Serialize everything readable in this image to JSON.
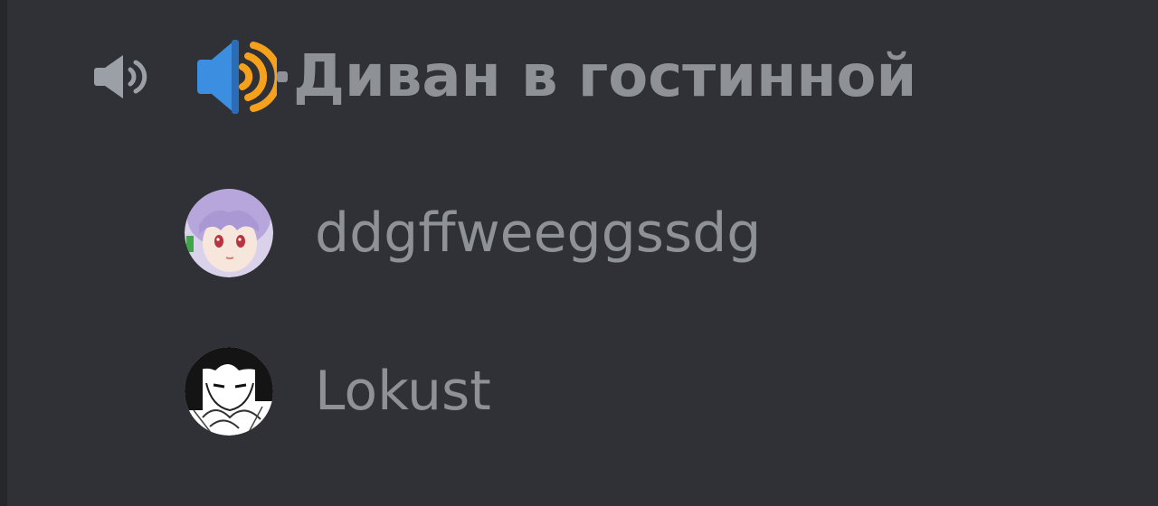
{
  "voice_channel": {
    "name": "Диван в гостинной",
    "icons": {
      "voice": "speaker-icon",
      "emoji": "loud-speaker-emoji-icon"
    }
  },
  "users": [
    {
      "name": "ddgffweeggssdg",
      "avatar": "anime-girl-purple-hair-avatar"
    },
    {
      "name": "Lokust",
      "avatar": "anime-manga-sketch-avatar"
    }
  ],
  "colors": {
    "background": "#2f3136",
    "text_muted": "#8e9297",
    "emoji_blue": "#3b8ee0",
    "emoji_orange": "#f5a11c"
  }
}
